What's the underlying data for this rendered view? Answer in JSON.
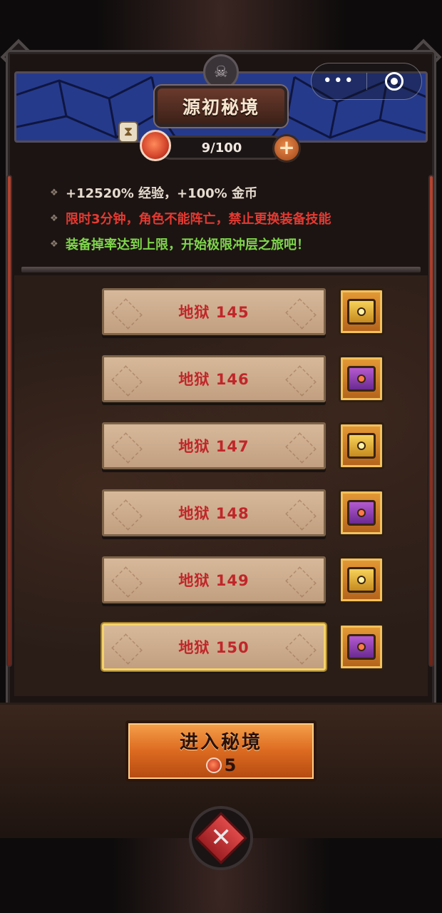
{
  "header": {
    "title": "源初秘境",
    "stamina": "9/100",
    "plus_symbol": "+"
  },
  "capsule": {
    "more_label": "•••"
  },
  "info": {
    "line1": "+12520% 经验，+100% 金币",
    "line2": "限时3分钟，角色不能阵亡，禁止更换装备技能",
    "line3": "装备掉率达到上限，开始极限冲层之旅吧！",
    "bullet": "❖"
  },
  "levels": [
    {
      "label": "地狱 145",
      "chest": "gold-chest-icon"
    },
    {
      "label": "地狱 146",
      "chest": "purple-chest-icon"
    },
    {
      "label": "地狱 147",
      "chest": "gold-chest-icon"
    },
    {
      "label": "地狱 148",
      "chest": "purple-chest-icon"
    },
    {
      "label": "地狱 149",
      "chest": "gold-chest-icon"
    },
    {
      "label": "地狱 150",
      "chest": "purple-chest-icon",
      "selected": true
    }
  ],
  "enter": {
    "label": "进入秘境",
    "cost": "5"
  },
  "close_symbol": "✕",
  "colors": {
    "warning_red": "#e43a32",
    "success_green": "#7fd64c",
    "level_text": "#c0262a",
    "accent_orange": "#dc6a20"
  }
}
